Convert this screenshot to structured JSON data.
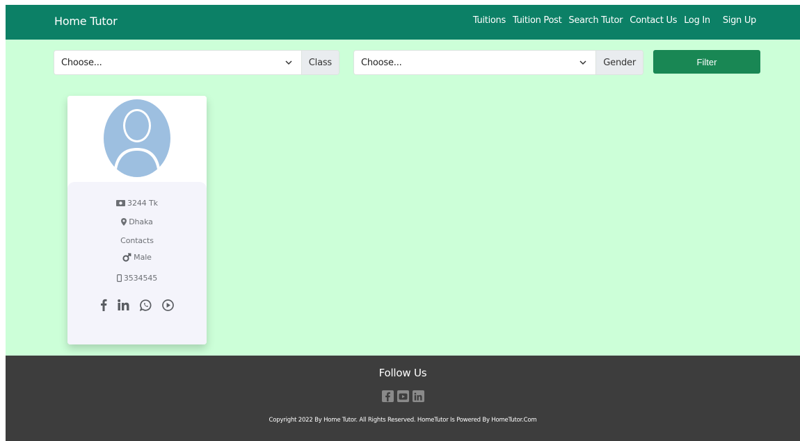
{
  "navbar": {
    "brand": "Home Tutor",
    "links": [
      "Tuitions",
      "Tuition Post",
      "Search Tutor",
      "Contact Us",
      "Log In",
      "Sign Up"
    ]
  },
  "filters": {
    "class_select_value": "Choose...",
    "class_label": "Class",
    "gender_select_value": "Choose...",
    "gender_label": "Gender",
    "filter_button": "Filter"
  },
  "tutor_card": {
    "salary": "3244 Tk",
    "location": "Dhaka",
    "contacts_label": "Contacts",
    "gender": "Male",
    "phone": "3534545",
    "social_icons": [
      "facebook-icon",
      "linkedin-icon",
      "whatsapp-icon",
      "play-icon"
    ]
  },
  "footer": {
    "follow_title": "Follow Us",
    "icons": [
      "facebook-square-icon",
      "youtube-square-icon",
      "linkedin-square-icon"
    ],
    "copyright": "Copyright 2022 By Home Tutor. All Rights Reserved. HomeTutor Is Powered By HomeTutor.Com"
  },
  "colors": {
    "navbar": "#0c8066",
    "background": "#ccffd8",
    "filter_button": "#198754",
    "footer": "#3d3d3d",
    "avatar": "#9dbfe0"
  }
}
